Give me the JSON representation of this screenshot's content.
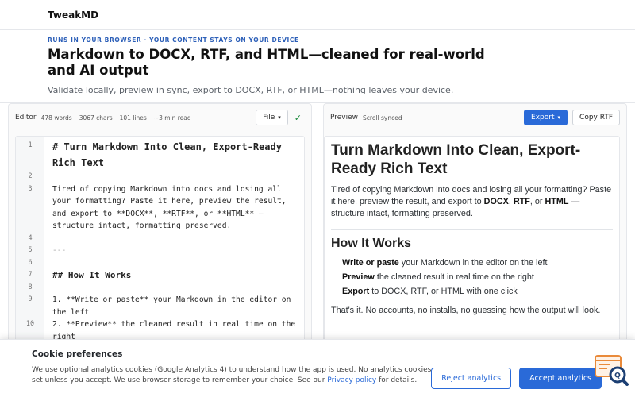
{
  "app": {
    "brand": "TweakMD"
  },
  "hero": {
    "eyebrow": "RUNS IN YOUR BROWSER · YOUR CONTENT STAYS ON YOUR DEVICE",
    "headline": "Markdown to DOCX, RTF, and HTML—cleaned for real-world and AI output",
    "subline": "Validate locally, preview in sync, export to DOCX, RTF, or HTML—nothing leaves your device."
  },
  "editor": {
    "title": "Editor",
    "stats": [
      "478 words",
      "3067 chars",
      "101 lines",
      "~3 min read"
    ],
    "file_label": "File",
    "lines": [
      {
        "n": "1",
        "text": "# Turn Markdown Into Clean, Export-Ready Rich Text",
        "style": "h1"
      },
      {
        "n": "2",
        "text": "",
        "style": ""
      },
      {
        "n": "3",
        "text": "Tired of copying Markdown into docs and losing all your formatting? Paste it here, preview the result, and export to **DOCX**, **RTF**, or **HTML** — structure intact, formatting preserved.",
        "style": ""
      },
      {
        "n": "4",
        "text": "",
        "style": ""
      },
      {
        "n": "5",
        "text": "---",
        "style": "hr"
      },
      {
        "n": "6",
        "text": "",
        "style": ""
      },
      {
        "n": "7",
        "text": "## How It Works",
        "style": "h2"
      },
      {
        "n": "8",
        "text": "",
        "style": ""
      },
      {
        "n": "9",
        "text": "1. **Write or paste** your Markdown in the editor on the left",
        "style": ""
      },
      {
        "n": "10",
        "text": "2. **Preview** the cleaned result in real time on the right",
        "style": ""
      }
    ]
  },
  "preview": {
    "title": "Preview",
    "sync_status": "Scroll synced",
    "export_label": "Export",
    "copy_rtf_label": "Copy RTF",
    "h1": "Turn Markdown Into Clean, Export-Ready Rich Text",
    "intro_a": "Tired of copying Markdown into docs and losing all your formatting? Paste it here, preview the result, and export to ",
    "intro_docx": "DOCX",
    "intro_sep1": ", ",
    "intro_rtf": "RTF",
    "intro_sep2": ", or ",
    "intro_html": "HTML",
    "intro_b": " — structure intact, formatting preserved.",
    "h2": "How It Works",
    "steps": [
      {
        "bold": "Write or paste",
        "rest": " your Markdown in the editor on the left"
      },
      {
        "bold": "Preview",
        "rest": " the cleaned result in real time on the right"
      },
      {
        "bold": "Export",
        "rest": " to DOCX, RTF, or HTML with one click"
      }
    ],
    "outro": "That's it. No accounts, no installs, no guessing how the output will look."
  },
  "cookie": {
    "title": "Cookie preferences",
    "text_a": "We use optional analytics cookies (Google Analytics 4) to understand how the app is used. No analytics cookies are set unless you accept. We use browser storage to remember your choice. See our ",
    "link": "Privacy policy",
    "text_b": " for details.",
    "reject_label": "Reject analytics",
    "accept_label": "Accept analytics"
  },
  "colors": {
    "accent": "#2a6ad8",
    "eyebrow": "#2c5fb8",
    "ok": "#1a8a3a"
  },
  "icons": {
    "sync_ok": "check-icon",
    "floating": "search-widget-icon"
  }
}
